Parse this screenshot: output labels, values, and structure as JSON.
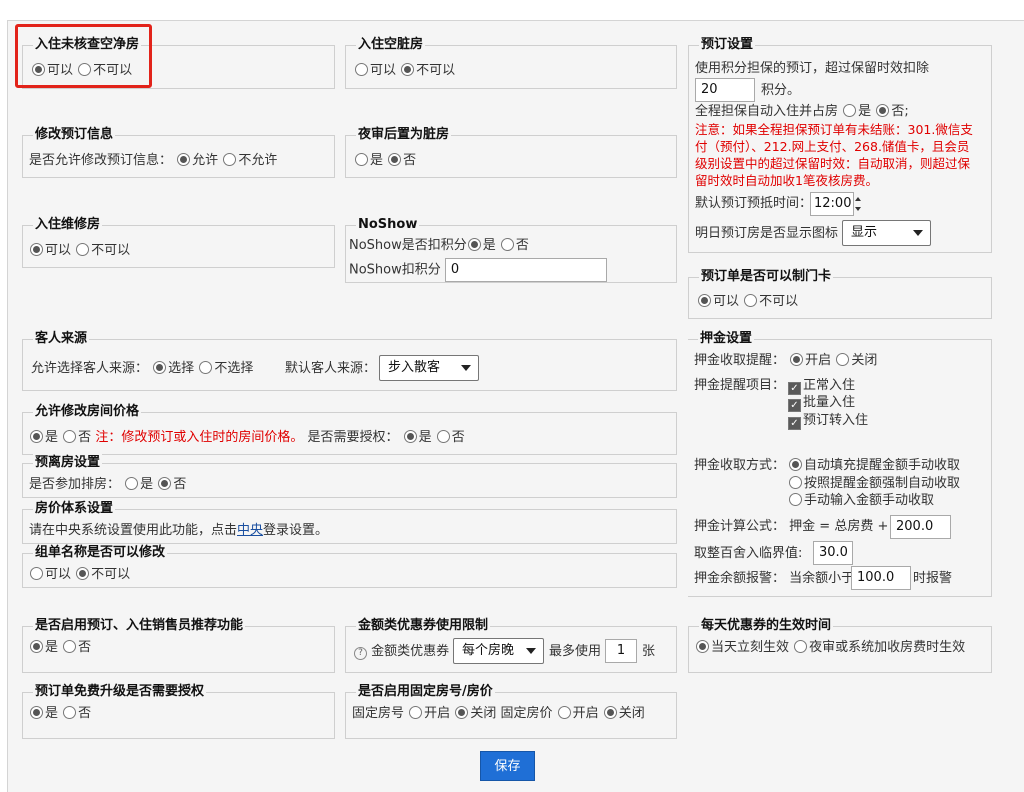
{
  "save_label": "保存",
  "checkin_unchecked_clean": {
    "title": "入住未核查空净房",
    "opt_yes": "可以",
    "opt_no": "不可以"
  },
  "checkin_dirty": {
    "title": "入住空脏房",
    "opt_yes": "可以",
    "opt_no": "不可以"
  },
  "modify_booking": {
    "title": "修改预订信息",
    "question": "是否允许修改预订信息：",
    "opt_yes": "允许",
    "opt_no": "不允许"
  },
  "night_audit_dirty": {
    "title": "夜审后置为脏房",
    "opt_yes": "是",
    "opt_no": "否"
  },
  "checkin_repair": {
    "title": "入住维修房",
    "opt_yes": "可以",
    "opt_no": "不可以"
  },
  "noshow": {
    "title": "NoShow",
    "deduct_label": "NoShow是否扣积分",
    "opt_yes": "是",
    "opt_no": "否",
    "points_label": "NoShow扣积分",
    "points_value": "0"
  },
  "guest_source": {
    "title": "客人来源",
    "allow_label": "允许选择客人来源：",
    "opt_select": "选择",
    "opt_noselect": "不选择",
    "default_label": "默认客人来源：",
    "default_value": "步入散客"
  },
  "modify_price": {
    "title": "允许修改房间价格",
    "opt_yes": "是",
    "opt_no": "否",
    "note": "注：修改预订或入住时的房间价格。",
    "auth_label": "是否需要授权：",
    "auth_yes": "是",
    "auth_no": "否"
  },
  "predepart": {
    "title": "预离房设置",
    "label": "是否参加排房：",
    "opt_yes": "是",
    "opt_no": "否"
  },
  "price_system": {
    "title": "房价体系设置",
    "text_before": "请在中央系统设置使用此功能，点击",
    "link": "中央",
    "text_after": "登录设置。"
  },
  "group_name": {
    "title": "组单名称是否可以修改",
    "opt_yes": "可以",
    "opt_no": "不可以"
  },
  "sales_recommend": {
    "title": "是否启用预订、入住销售员推荐功能",
    "opt_yes": "是",
    "opt_no": "否"
  },
  "coupon_limit": {
    "title": "金额类优惠券使用限制",
    "help": "?",
    "label": "金额类优惠券",
    "select_value": "每个房晚",
    "max_label": "最多使用",
    "max_value": "1",
    "unit": "张"
  },
  "free_upgrade": {
    "title": "预订单免费升级是否需要授权",
    "opt_yes": "是",
    "opt_no": "否"
  },
  "fixed_room": {
    "title": "是否启用固定房号/房价",
    "room_label": "固定房号",
    "room_on": "开启",
    "room_off": "关闭",
    "price_label": "固定房价",
    "price_on": "开启",
    "price_off": "关闭"
  },
  "booking_settings": {
    "title": "预订设置",
    "guarantee_text": "使用积分担保的预订，超过保留时效扣除",
    "guarantee_value": "20",
    "guarantee_unit": "积分。",
    "auto_checkin_label": "全程担保自动入住并占房",
    "auto_yes": "是",
    "auto_no": "否;",
    "note_line1": "注意：如果全程担保预订单有未结账：301.微信支",
    "note_line2": "付（预付）、212.网上支付、268.储值卡，且会员",
    "note_line3": "级别设置中的超过保留时效：自动取消，则超过保",
    "note_line4": "留时效时自动加收1笔夜核房费。",
    "default_time_label": "默认预订预抵时间：",
    "default_time_value": "12:00",
    "tomorrow_label": "明日预订房是否显示图标",
    "tomorrow_value": "显示"
  },
  "booking_card": {
    "title": "预订单是否可以制门卡",
    "opt_yes": "可以",
    "opt_no": "不可以"
  },
  "deposit": {
    "title": "押金设置",
    "remind_label": "押金收取提醒：",
    "remind_on": "开启",
    "remind_off": "关闭",
    "items_label": "押金提醒项目：",
    "items": [
      "正常入住",
      "批量入住",
      "预订转入住"
    ],
    "method_label": "押金收取方式：",
    "methods": [
      "自动填充提醒金额手动收取",
      "按照提醒金额强制自动收取",
      "手动输入金额手动收取"
    ],
    "formula_label": "押金计算公式：",
    "formula_text": "押金 = 总房费 +",
    "formula_value": "200.0",
    "round_label": "取整百舍入临界值:",
    "round_value": "30.0",
    "alert_label": "押金余额报警：",
    "alert_text": "当余额小于",
    "alert_value": "100.0",
    "alert_suffix": "时报警"
  },
  "coupon_effective": {
    "title": "每天优惠券的生效时间",
    "opt_now": "当天立刻生效",
    "opt_audit": "夜审或系统加收房费时生效"
  }
}
